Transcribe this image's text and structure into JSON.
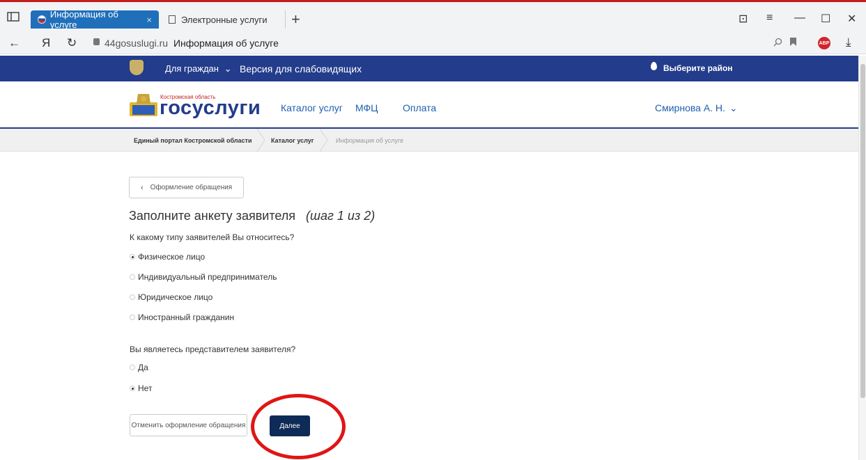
{
  "browser": {
    "tabs": [
      {
        "title": "Информация об услуге",
        "close": "×"
      },
      {
        "title": "Электронные услуги"
      }
    ],
    "new_tab": "+",
    "window_controls": [
      "⊡",
      "≡",
      "—",
      "☐",
      "✕"
    ],
    "nav": {
      "back": "←",
      "yandex": "Я",
      "reload": "↻"
    },
    "url_domain": "44gosuslugi.ru",
    "url_title": "Информация об услуге",
    "adblock_label": "ABP",
    "download": "⤓",
    "icons": [
      "sidebar-icon",
      "search-icon",
      "bookmark-icon",
      "lock-icon",
      "adblock-icon",
      "download-icon"
    ]
  },
  "topbar": {
    "for_citizens": "Для граждан",
    "chevron": "⌄",
    "low_vision": "Версия для слабовидящих",
    "region": "Выберите район"
  },
  "header": {
    "logo_small": "Костромская область",
    "logo_text": "госуслуги",
    "menu": [
      "Каталог услуг",
      "МФЦ",
      "Оплата"
    ],
    "user": "Смирнова А. Н.",
    "user_chevron": "⌄"
  },
  "breadcrumbs": [
    "Единый портал Костромской области",
    "Каталог услуг",
    "Информация об услуге"
  ],
  "form": {
    "back_button": "Оформление обращения",
    "back_chevron": "‹",
    "title": "Заполните анкету заявителя",
    "step": "(шаг 1 из 2)",
    "question1": "К какому типу заявителей Вы относитесь?",
    "options1": [
      {
        "label": "Физическое лицо",
        "checked": true
      },
      {
        "label": "Индивидуальный предприниматель",
        "checked": false
      },
      {
        "label": "Юридическое лицо",
        "checked": false
      },
      {
        "label": "Иностранный гражданин",
        "checked": false
      }
    ],
    "question2": "Вы являетесь представителем заявителя?",
    "options2": [
      {
        "label": "Да",
        "checked": false
      },
      {
        "label": "Нет",
        "checked": true
      }
    ],
    "cancel_button": "Отменить оформление обращения",
    "next_button": "Далее"
  },
  "colors": {
    "primary_blue": "#233c8b",
    "next_button": "#0e2a56",
    "annotation_red": "#e01515",
    "active_tab": "#1f6fba"
  }
}
